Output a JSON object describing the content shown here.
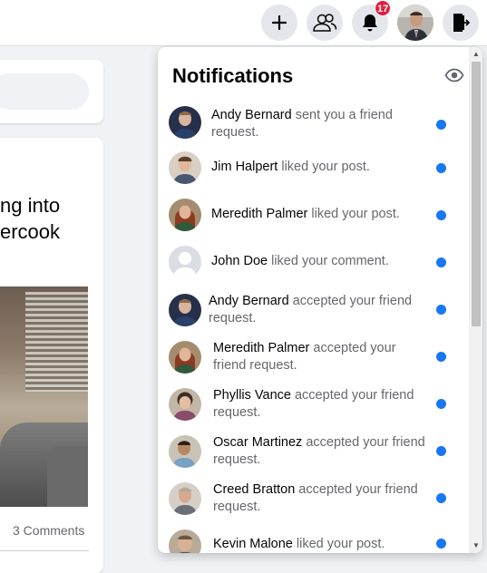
{
  "topbar": {
    "notification_count": "17",
    "icons": [
      "plus-icon",
      "friends-icon",
      "bell-icon",
      "profile-avatar",
      "logout-icon"
    ]
  },
  "feed": {
    "post_text_line1": "ng into",
    "post_text_line2": "ercook",
    "comments_label": "3 Comments"
  },
  "notifications": {
    "title": "Notifications",
    "items": [
      {
        "name": "Andy Bernard",
        "action": " sent you a friend request.",
        "unread": true
      },
      {
        "name": "Jim Halpert",
        "action": " liked your post.",
        "unread": true
      },
      {
        "name": "Meredith Palmer",
        "action": " liked your post.",
        "unread": true
      },
      {
        "name": "John Doe",
        "action": " liked your comment.",
        "unread": true
      },
      {
        "name": "Andy Bernard",
        "action": " accepted your friend request.",
        "unread": true
      },
      {
        "name": "Meredith Palmer",
        "action": " accepted your friend request.",
        "unread": true
      },
      {
        "name": "Phyllis Vance",
        "action": " accepted your friend request.",
        "unread": true
      },
      {
        "name": "Oscar Martinez",
        "action": " accepted your friend request.",
        "unread": true
      },
      {
        "name": "Creed Bratton",
        "action": " accepted your friend request.",
        "unread": true
      },
      {
        "name": "Kevin Malone",
        "action": " liked your post.",
        "unread": true
      }
    ]
  },
  "colors": {
    "unread_dot": "#1877f2",
    "badge": "#e41e3f",
    "background": "#f0f2f5"
  }
}
